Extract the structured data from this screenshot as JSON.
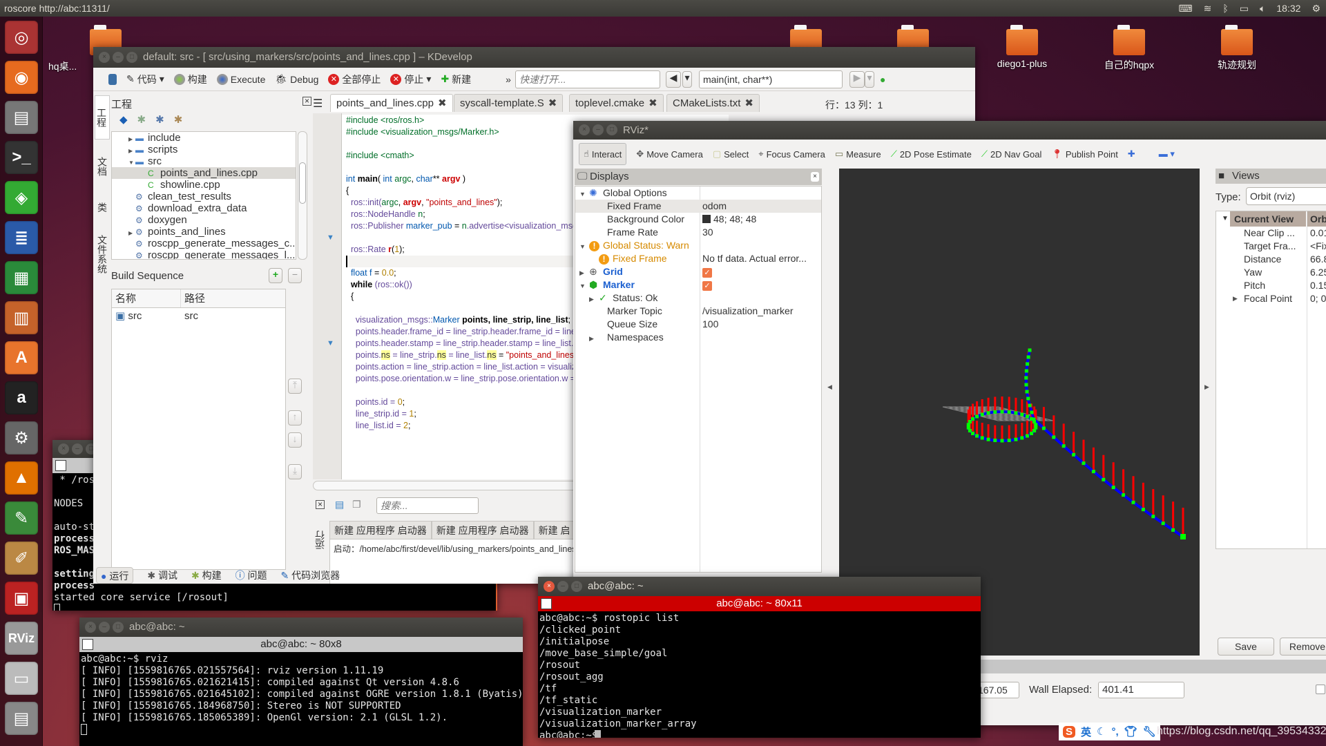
{
  "topbar": {
    "title": "roscore http://abc:11311/",
    "clock": "18:32",
    "tray_icons": [
      "keyboard-icon",
      "wifi-icon",
      "bluetooth-icon",
      "battery-icon",
      "volume-icon",
      "gear-icon"
    ]
  },
  "launcher": {
    "items": [
      "ubuntu-dash-icon",
      "firefox-icon",
      "files-icon",
      "terminal-icon",
      "network-icon",
      "writer-icon",
      "calc-icon",
      "impress-icon",
      "software-center-icon",
      "amazon-icon",
      "system-settings-icon",
      "vlc-icon",
      "text-editor-icon",
      "paint-icon",
      "workspace-icon",
      "rviz-icon",
      "drive-icon",
      "trash-icon"
    ],
    "rviz_label": "RViz"
  },
  "desktop": {
    "icons": [
      {
        "label": "hq桌..."
      },
      {
        "label": ""
      },
      {
        "label": ""
      },
      {
        "label": "diego1-plus"
      },
      {
        "label": "自己的hqpx"
      },
      {
        "label": "轨迹规划"
      }
    ]
  },
  "kdevelop": {
    "title": "default:  src - [ src/using_markers/src/points_and_lines.cpp ] – KDevelop",
    "toolbar": {
      "code": "代码",
      "build": "构建",
      "execute": "Execute",
      "debug": "Debug",
      "stop_all": "全部停止",
      "stop": "停止",
      "new": "新建",
      "more": "»",
      "quick_open_placeholder": "快速打开...",
      "function": "main(int, char**)"
    },
    "side_tabs": [
      "工程",
      "文档",
      "类",
      "文件系统"
    ],
    "project": {
      "title": "工程",
      "tree": [
        {
          "label": "include",
          "indent": 1,
          "arrow": "▶",
          "icon": "folder"
        },
        {
          "label": "scripts",
          "indent": 1,
          "arrow": "▶",
          "icon": "folder"
        },
        {
          "label": "src",
          "indent": 1,
          "arrow": "▼",
          "icon": "folder"
        },
        {
          "label": "points_and_lines.cpp",
          "indent": 2,
          "arrow": "",
          "icon": "cpp",
          "selected": true
        },
        {
          "label": "showline.cpp",
          "indent": 2,
          "arrow": "",
          "icon": "cpp"
        },
        {
          "label": "clean_test_results",
          "indent": 1,
          "arrow": "",
          "icon": "target"
        },
        {
          "label": "download_extra_data",
          "indent": 1,
          "arrow": "",
          "icon": "target"
        },
        {
          "label": "doxygen",
          "indent": 1,
          "arrow": "",
          "icon": "target"
        },
        {
          "label": "points_and_lines",
          "indent": 1,
          "arrow": "▶",
          "icon": "target"
        },
        {
          "label": "roscpp_generate_messages_c...",
          "indent": 1,
          "arrow": "",
          "icon": "target"
        },
        {
          "label": "roscpp_generate_messages_l...",
          "indent": 1,
          "arrow": "",
          "icon": "target"
        }
      ]
    },
    "build_sequence": {
      "title": "Build Sequence",
      "columns": [
        "名称",
        "路径"
      ],
      "rows": [
        [
          "src",
          "src"
        ]
      ]
    },
    "tabs": [
      {
        "label": "points_and_lines.cpp",
        "active": true
      },
      {
        "label": "syscall-template.S"
      },
      {
        "label": "toplevel.cmake"
      },
      {
        "label": "CMakeLists.txt"
      }
    ],
    "cursor_pos": "行：13 列：1",
    "code": [
      [
        [
          "#include <ros/ros.h>",
          "pp"
        ]
      ],
      [
        [
          "#include <visualization_msgs/Marker.h>",
          "pp"
        ]
      ],
      [],
      [
        [
          "#include <cmath>",
          "pp"
        ]
      ],
      [],
      [
        [
          "int ",
          "kw"
        ],
        [
          "main",
          "fn"
        ],
        [
          "( ",
          "d"
        ],
        [
          "int ",
          "kw"
        ],
        [
          "argc",
          "v"
        ],
        [
          ", ",
          "d"
        ],
        [
          "char",
          "kw"
        ],
        [
          "** ",
          "d"
        ],
        [
          "argv",
          "r"
        ],
        [
          " )",
          "d"
        ]
      ],
      [
        [
          "{",
          "d"
        ]
      ],
      [
        [
          "  ros::init(",
          "p"
        ],
        [
          "argc",
          "v"
        ],
        [
          ", ",
          "d"
        ],
        [
          "argv",
          "r"
        ],
        [
          ", ",
          "d"
        ],
        [
          "\"points_and_lines\"",
          "str"
        ],
        [
          ");",
          "d"
        ]
      ],
      [
        [
          "  ros::NodeHandle ",
          "p"
        ],
        [
          "n",
          "v"
        ],
        [
          ";",
          "d"
        ]
      ],
      [
        [
          "  ros::Publisher ",
          "p"
        ],
        [
          "marker_pub",
          "n"
        ],
        [
          " = ",
          "d"
        ],
        [
          "n",
          "v"
        ],
        [
          ".advertise<visualization_msgs::M",
          "p"
        ]
      ],
      [],
      [
        [
          "  ros::Rate ",
          "p"
        ],
        [
          "r",
          "r"
        ],
        [
          "(",
          "d"
        ],
        [
          "1",
          "num"
        ],
        [
          ");",
          "d"
        ]
      ],
      [],
      [
        [
          "  float ",
          "kw"
        ],
        [
          "f",
          "n"
        ],
        [
          " = ",
          "d"
        ],
        [
          "0.0",
          "num"
        ],
        [
          ";",
          "d"
        ]
      ],
      [
        [
          "  while",
          "fn"
        ],
        [
          " (ros::ok())",
          "p"
        ]
      ],
      [
        [
          "  {",
          "d"
        ]
      ],
      [],
      [
        [
          "    visualization_msgs::",
          "p"
        ],
        [
          "Marker ",
          "n"
        ],
        [
          "points, line_strip, line_list",
          "fn"
        ],
        [
          ";",
          "d"
        ]
      ],
      [
        [
          "    points.header.frame_id = line_strip.header.frame_id = line_lis",
          "p"
        ]
      ],
      [
        [
          "    points.header.stamp = line_strip.header.stamp = line_list.hea",
          "p"
        ]
      ],
      [
        [
          "    points.",
          "p"
        ],
        [
          "ns",
          "hl"
        ],
        [
          " = line_strip.",
          "p"
        ],
        [
          "ns",
          "hl"
        ],
        [
          " = line_list.",
          "p"
        ],
        [
          "ns",
          "hl"
        ],
        [
          " = ",
          "d"
        ],
        [
          "\"points_and_lines\"",
          "str"
        ],
        [
          ";",
          "d"
        ]
      ],
      [
        [
          "    points.action = line_strip.action = line_list.action = visualizatio",
          "p"
        ]
      ],
      [
        [
          "    points.pose.orientation.w = line_strip.pose.orientation.w = lin",
          "p"
        ]
      ],
      [],
      [
        [
          "    points.id = ",
          "p"
        ],
        [
          "0",
          "num"
        ],
        [
          ";",
          "d"
        ]
      ],
      [
        [
          "    line_strip.id = ",
          "p"
        ],
        [
          "1",
          "num"
        ],
        [
          ";",
          "d"
        ]
      ],
      [
        [
          "    line_list.id = ",
          "p"
        ],
        [
          "2",
          "num"
        ],
        [
          ";",
          "d"
        ]
      ]
    ],
    "output": {
      "search_placeholder": "搜索...",
      "tabs": [
        "新建 应用程序 启动器",
        "新建 应用程序 启动器",
        "新建 启"
      ],
      "text": "启动：/home/abc/first/devel/lib/using_markers/points_and_lines",
      "side_label": "运行"
    },
    "bottom_tabs": [
      "运行",
      "调试",
      "构建",
      "问题",
      "代码浏览器"
    ]
  },
  "rviz": {
    "title": "RViz*",
    "tools": [
      "Interact",
      "Move Camera",
      "Select",
      "Focus Camera",
      "Measure",
      "2D Pose Estimate",
      "2D Nav Goal",
      "Publish Point"
    ],
    "displays": {
      "title": "Displays",
      "rows": [
        {
          "key": "Global Options",
          "value": "",
          "indent": 0,
          "arrow": "▼",
          "icon": "gear",
          "style": ""
        },
        {
          "key": "Fixed Frame",
          "value": "odom",
          "indent": 1,
          "arrow": "",
          "icon": "",
          "style": "sel"
        },
        {
          "key": "Background Color",
          "value": "48; 48; 48",
          "indent": 1,
          "arrow": "",
          "icon": "",
          "style": "",
          "swatch": "#303030"
        },
        {
          "key": "Frame Rate",
          "value": "30",
          "indent": 1,
          "arrow": "",
          "icon": "",
          "style": ""
        },
        {
          "key": "Global Status: Warn",
          "value": "",
          "indent": 0,
          "arrow": "▼",
          "icon": "warn",
          "style": "warn"
        },
        {
          "key": "Fixed Frame",
          "value": "No tf data.  Actual error...",
          "indent": 1,
          "arrow": "",
          "icon": "warn",
          "style": "warn"
        },
        {
          "key": "Grid",
          "value": "",
          "indent": 0,
          "arrow": "▶",
          "icon": "grid",
          "style": "blue",
          "checked": true
        },
        {
          "key": "Marker",
          "value": "",
          "indent": 0,
          "arrow": "▼",
          "icon": "marker",
          "style": "blue",
          "checked": true
        },
        {
          "key": "Status: Ok",
          "value": "",
          "indent": 1,
          "arrow": "▶",
          "icon": "check",
          "style": ""
        },
        {
          "key": "Marker Topic",
          "value": "/visualization_marker",
          "indent": 1,
          "arrow": "",
          "icon": "",
          "style": ""
        },
        {
          "key": "Queue Size",
          "value": "100",
          "indent": 1,
          "arrow": "",
          "icon": "",
          "style": ""
        },
        {
          "key": "Namespaces",
          "value": "",
          "indent": 1,
          "arrow": "▶",
          "icon": "",
          "style": ""
        }
      ]
    },
    "views": {
      "title": "Views",
      "type_label": "Type:",
      "type_value": "Orbit (rviz)",
      "current_view": "Current View",
      "current_view_value": "Orb",
      "rows": [
        {
          "key": "Near Clip ...",
          "value": "0.01"
        },
        {
          "key": "Target Fra...",
          "value": "<Fix"
        },
        {
          "key": "Distance",
          "value": "66.8"
        },
        {
          "key": "Yaw",
          "value": "6.25"
        },
        {
          "key": "Pitch",
          "value": "0.15"
        },
        {
          "key": "Focal Point",
          "value": "0; 0",
          "arrow": "▶"
        }
      ],
      "save": "Save",
      "remove": "Remove"
    },
    "time": {
      "ros_elapsed_value": "167.05",
      "wall_elapsed_label": "Wall Elapsed:",
      "wall_elapsed_value": "401.41"
    },
    "colors": {
      "background": "#303030",
      "points": "#00ff00",
      "line_strip": "#0000ff",
      "line_list": "#ff0000"
    }
  },
  "terminals": {
    "roscore": {
      "lines": [
        " * /ros",
        "",
        "NODES",
        "",
        "auto-st",
        "process",
        "ROS_MAS",
        "",
        "setting",
        "process",
        "started core service [/rosout]"
      ]
    },
    "rviz": {
      "title": "abc@abc: ~",
      "header": "abc@abc: ~ 80x8",
      "lines": [
        "abc@abc:~$ rviz",
        "[ INFO] [1559816765.021557564]: rviz version 1.11.19",
        "[ INFO] [1559816765.021621415]: compiled against Qt version 4.8.6",
        "[ INFO] [1559816765.021645102]: compiled against OGRE version 1.8.1 (Byatis)",
        "[ INFO] [1559816765.184968750]: Stereo is NOT SUPPORTED",
        "[ INFO] [1559816765.185065389]: OpenGl version: 2.1 (GLSL 1.2)."
      ]
    },
    "rostopic": {
      "title": "abc@abc: ~",
      "header": "abc@abc: ~ 80x11",
      "lines": [
        "abc@abc:~$ rostopic list",
        "/clicked_point",
        "/initialpose",
        "/move_base_simple/goal",
        "/rosout",
        "/rosout_agg",
        "/tf",
        "/tf_static",
        "/visualization_marker",
        "/visualization_marker_array",
        "abc@abc:~$ "
      ]
    }
  },
  "ime": {
    "label": "英",
    "watermark": "https://blog.csdn.net/qq_39534332"
  }
}
